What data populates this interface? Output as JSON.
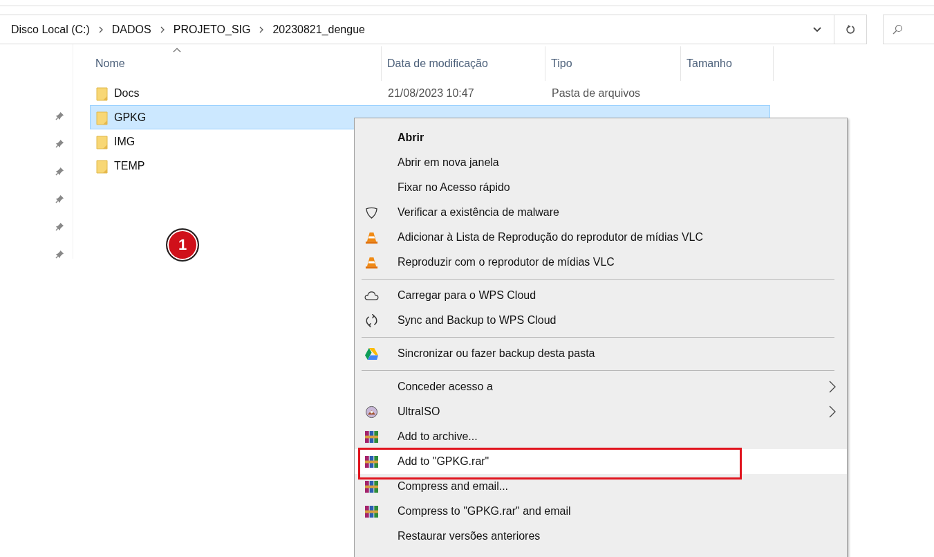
{
  "address_bar": {
    "path": [
      "Disco Local (C:)",
      "DADOS",
      "PROJETO_SIG",
      "20230821_dengue"
    ]
  },
  "columns": [
    {
      "label": "Nome",
      "sorted": true
    },
    {
      "label": "Data de modificação",
      "sorted": false
    },
    {
      "label": "Tipo",
      "sorted": false
    },
    {
      "label": "Tamanho",
      "sorted": false
    }
  ],
  "files": [
    {
      "name": "Docs",
      "date": "21/08/2023 10:47",
      "type": "Pasta de arquivos",
      "selected": false
    },
    {
      "name": "GPKG",
      "selected": true
    },
    {
      "name": "IMG",
      "selected": false
    },
    {
      "name": "TEMP",
      "selected": false
    }
  ],
  "step_badge": "1",
  "context_menu": {
    "items": [
      {
        "kind": "plain",
        "label": "Abrir",
        "bold": true,
        "submenu": false,
        "selected": false,
        "annotated": false
      },
      {
        "kind": "plain",
        "label": "Abrir em nova janela",
        "bold": false,
        "submenu": false,
        "selected": false,
        "annotated": false
      },
      {
        "kind": "plain",
        "label": "Fixar no Acesso rápido",
        "bold": false,
        "submenu": false,
        "selected": false,
        "annotated": false
      },
      {
        "kind": "shield",
        "label": "Verificar a existência de malware",
        "bold": false,
        "submenu": false,
        "selected": false,
        "annotated": false
      },
      {
        "kind": "cone",
        "label": "Adicionar à Lista de Reprodução do reprodutor de mídias VLC",
        "bold": false,
        "submenu": false,
        "selected": false,
        "annotated": false
      },
      {
        "kind": "cone",
        "label": "Reproduzir com o reprodutor de mídias VLC",
        "bold": false,
        "submenu": false,
        "selected": false,
        "annotated": false
      },
      {
        "kind": "separator"
      },
      {
        "kind": "cloud",
        "label": "Carregar para o WPS Cloud",
        "bold": false,
        "submenu": false,
        "selected": false,
        "annotated": false
      },
      {
        "kind": "sync",
        "label": "Sync and Backup to WPS Cloud",
        "bold": false,
        "submenu": false,
        "selected": false,
        "annotated": false
      },
      {
        "kind": "separator"
      },
      {
        "kind": "drive",
        "label": "Sincronizar ou fazer backup desta pasta",
        "bold": false,
        "submenu": false,
        "selected": false,
        "annotated": false
      },
      {
        "kind": "separator"
      },
      {
        "kind": "plain",
        "label": "Conceder acesso a",
        "bold": false,
        "submenu": true,
        "selected": false,
        "annotated": false
      },
      {
        "kind": "disc",
        "label": "UltraISO",
        "bold": false,
        "submenu": true,
        "selected": false,
        "annotated": false
      },
      {
        "kind": "archive",
        "label": "Add to archive...",
        "bold": false,
        "submenu": false,
        "selected": false,
        "annotated": false
      },
      {
        "kind": "archive",
        "label": "Add to \"GPKG.rar\"",
        "bold": false,
        "submenu": false,
        "selected": true,
        "annotated": true
      },
      {
        "kind": "archive",
        "label": "Compress and email...",
        "bold": false,
        "submenu": false,
        "selected": false,
        "annotated": false
      },
      {
        "kind": "archive",
        "label": "Compress to \"GPKG.rar\" and email",
        "bold": false,
        "submenu": false,
        "selected": false,
        "annotated": false
      },
      {
        "kind": "plain",
        "label": "Restaurar versões anteriores",
        "bold": false,
        "submenu": false,
        "selected": false,
        "annotated": false
      }
    ]
  }
}
